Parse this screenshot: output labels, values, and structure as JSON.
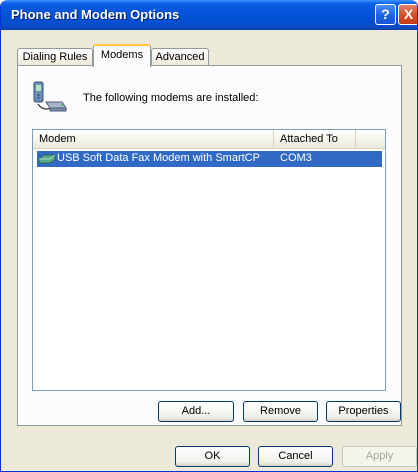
{
  "window": {
    "title": "Phone and Modem Options",
    "help_label": "?",
    "close_label": "X"
  },
  "tabs": [
    {
      "label": "Dialing Rules",
      "active": false
    },
    {
      "label": "Modems",
      "active": true
    },
    {
      "label": "Advanced",
      "active": false
    }
  ],
  "modems": {
    "intro": "The following modems are installed:",
    "columns": [
      "Modem",
      "Attached To"
    ],
    "rows": [
      {
        "modem": "USB Soft Data Fax Modem with SmartCP",
        "attached_to": "COM3",
        "selected": true,
        "icon": "modem-icon"
      }
    ],
    "add_label": "Add...",
    "remove_label": "Remove",
    "properties_label": "Properties"
  },
  "footer": {
    "ok_label": "OK",
    "cancel_label": "Cancel",
    "apply_label": "Apply"
  },
  "colors": {
    "titlebar": "#0454d8",
    "selection": "#316ac5",
    "active_tab_accent": "#ffc83c"
  }
}
